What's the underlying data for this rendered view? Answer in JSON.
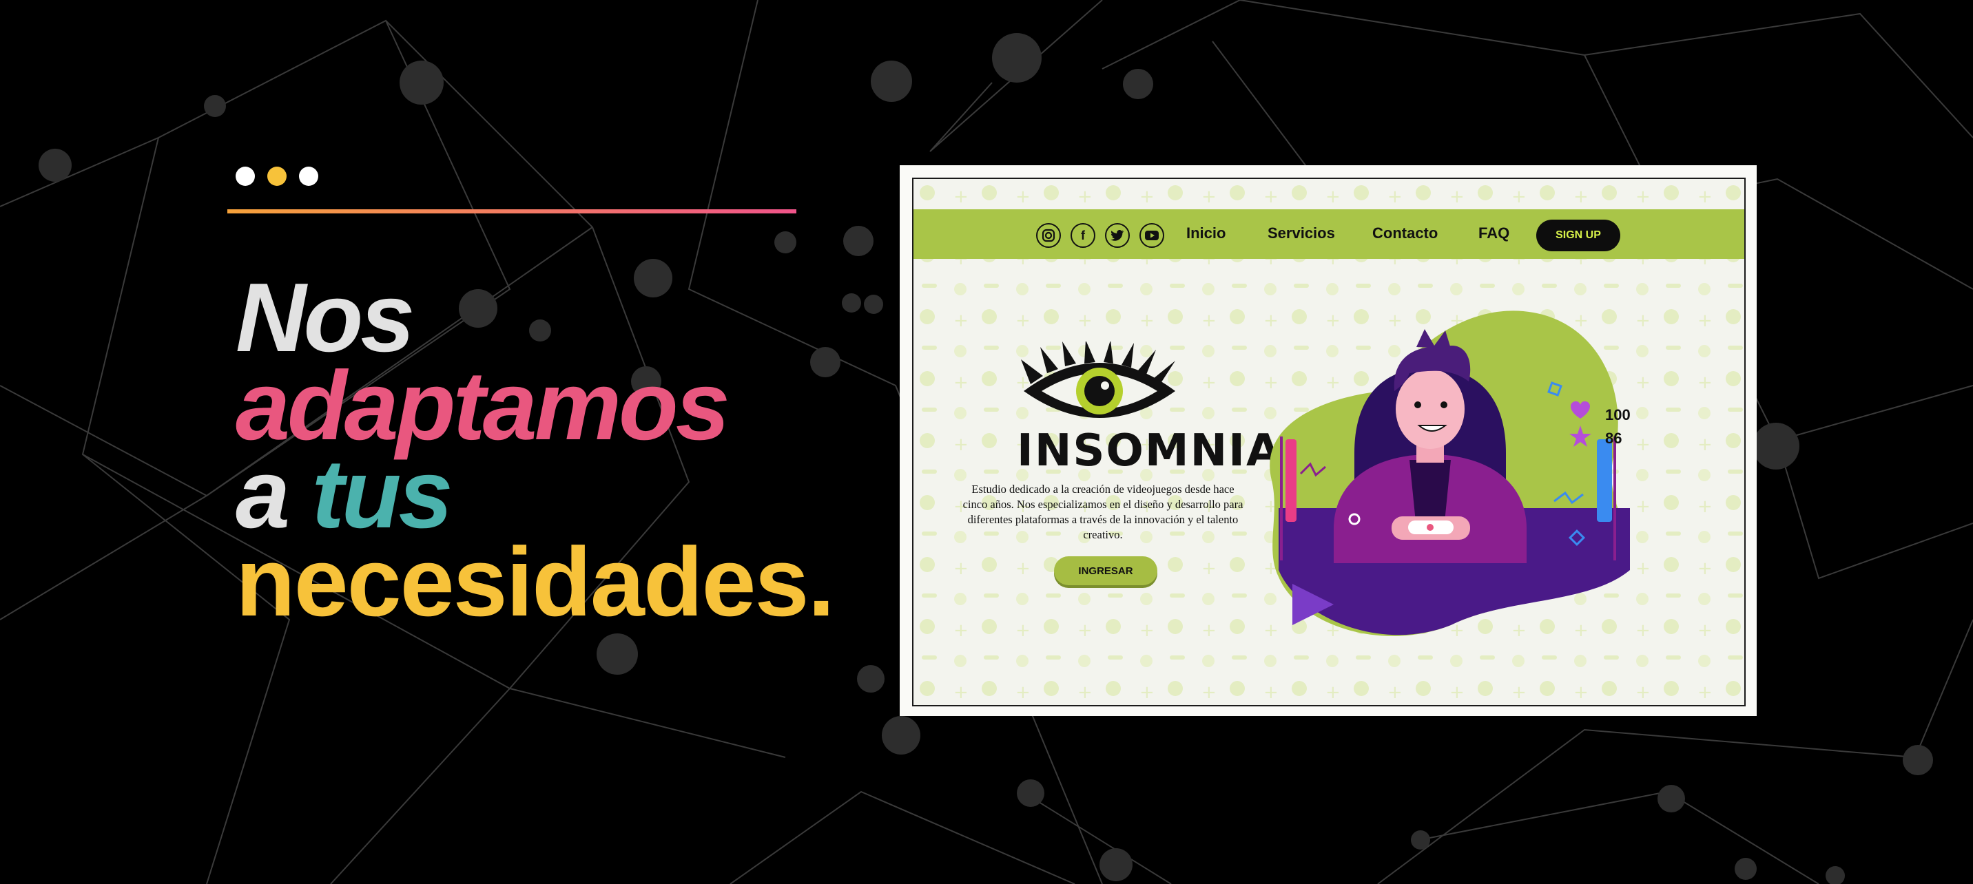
{
  "colors": {
    "background": "#000000",
    "accent_pink": "#e9577f",
    "accent_yellow": "#f7c23a",
    "accent_teal": "#4bb2ad",
    "light_gray": "#e2e2e2",
    "nav_green": "#a9c548",
    "purple": "#5a1c8f"
  },
  "hero": {
    "line1": "Nos",
    "line2": "adaptamos",
    "line3_a": "a",
    "line3_b": "tus",
    "line4": "necesidades."
  },
  "mockup": {
    "social_icons": [
      "instagram-icon",
      "facebook-icon",
      "twitter-icon",
      "youtube-icon"
    ],
    "nav": {
      "links": [
        "Inicio",
        "Servicios",
        "Contacto",
        "FAQ"
      ],
      "signup_label": "SIGN UP"
    },
    "brand": "INSOMNIA",
    "description": "Estudio dedicado a la creación de videojuegos desde hace cinco años.  Nos especializamos en el diseño y desarrollo  para diferentes plataformas a través de la innovación y el talento creativo.",
    "cta_label": "INGRESAR",
    "stats": {
      "likes": "100",
      "stars": "86"
    }
  }
}
